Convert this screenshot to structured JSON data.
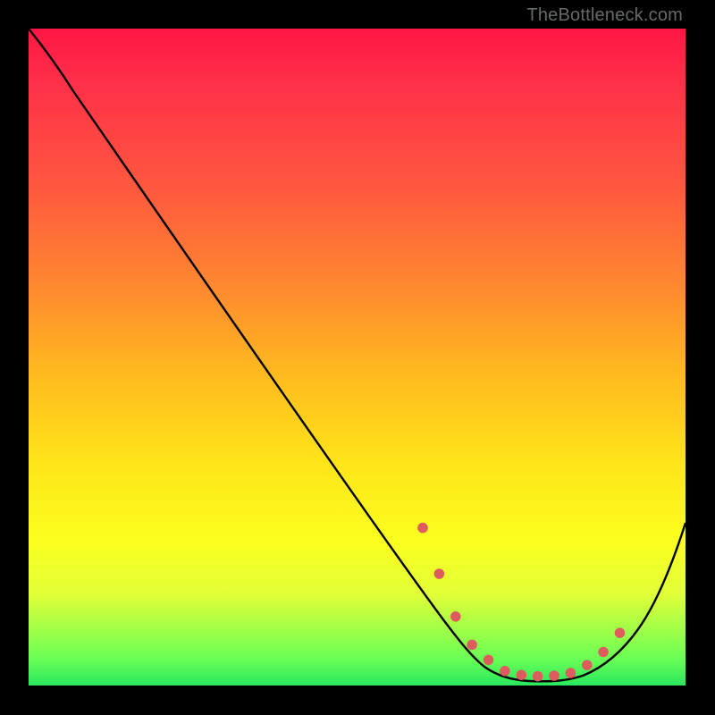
{
  "watermark": "TheBottleneck.com",
  "chart_data": {
    "type": "line",
    "title": "",
    "xlabel": "",
    "ylabel": "",
    "xlim": [
      0,
      100
    ],
    "ylim": [
      0,
      100
    ],
    "grid": false,
    "legend": false,
    "series": [
      {
        "name": "curve",
        "x": [
          0,
          5,
          10,
          15,
          20,
          25,
          30,
          35,
          40,
          45,
          50,
          55,
          60,
          63,
          67,
          70,
          75,
          80,
          83,
          86,
          90,
          95,
          100
        ],
        "y": [
          100,
          95.5,
          90,
          84,
          77.5,
          71,
          64.5,
          58,
          51.5,
          45,
          38.5,
          32,
          25,
          18,
          10,
          5,
          1,
          0.5,
          0.5,
          1,
          5,
          14,
          25
        ]
      }
    ],
    "markers": {
      "name": "dotted-segment",
      "x": [
        60,
        62.5,
        65,
        67.5,
        70,
        72.5,
        75,
        77.5,
        80,
        82.5,
        85,
        87.5,
        90
      ],
      "y": [
        24,
        17,
        10.5,
        6.2,
        3.9,
        2.2,
        1.6,
        1.4,
        1.5,
        1.9,
        3.1,
        5.1,
        8.0
      ],
      "color": "#de5c5e"
    },
    "colors": {
      "curve": "#000000",
      "dots": "#de5c5e",
      "background_top": "#ff1744",
      "background_bottom": "#28e85e"
    }
  }
}
